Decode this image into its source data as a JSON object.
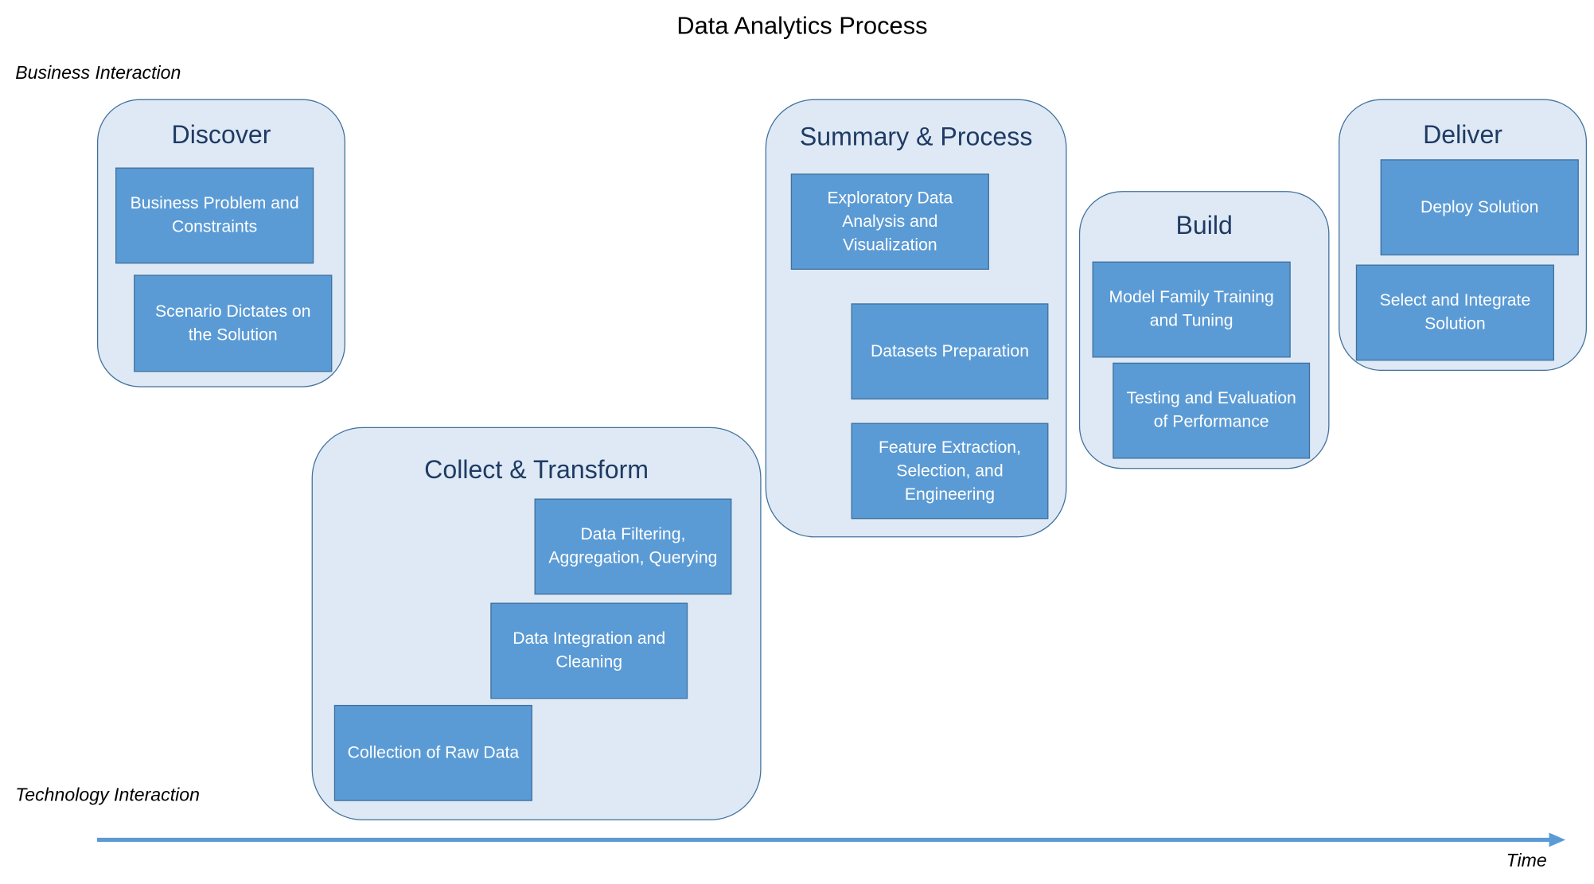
{
  "title": "Data Analytics Process",
  "axis": {
    "top_label": "Business Interaction",
    "bottom_label": "Technology Interaction",
    "time_label": "Time",
    "arrow_color": "#5b9bd5"
  },
  "colors": {
    "phase_fill": "#dee9f5",
    "phase_border": "#41719c",
    "step_fill": "#5b9bd5",
    "title_text": "#1f3b63"
  },
  "phases": [
    {
      "title": "Discover",
      "steps": [
        "Business Problem and Constraints",
        "Scenario Dictates on the Solution"
      ]
    },
    {
      "title": "Collect & Transform",
      "steps": [
        "Data Filtering, Aggregation, Querying",
        "Data Integration and Cleaning",
        "Collection of Raw Data"
      ]
    },
    {
      "title": "Summary & Process",
      "steps": [
        "Exploratory Data Analysis and Visualization",
        "Datasets Preparation",
        "Feature Extraction, Selection, and Engineering"
      ]
    },
    {
      "title": "Build",
      "steps": [
        "Model Family Training and Tuning",
        "Testing and Evaluation of Performance"
      ]
    },
    {
      "title": "Deliver",
      "steps": [
        "Deploy Solution",
        "Select and Integrate Solution"
      ]
    }
  ]
}
